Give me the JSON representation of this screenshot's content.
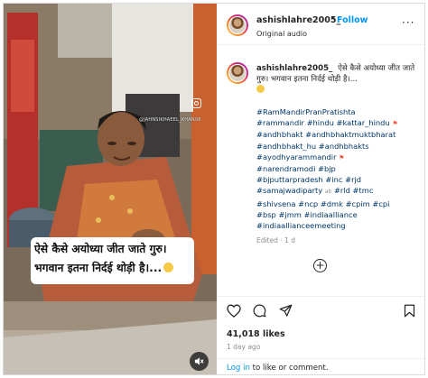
{
  "media": {
    "watermark": "@JAHNSIKHAEEL_KHAN98",
    "caption_line1": "ऐसे कैसे अयोध्या जीत जाते गुरु।",
    "caption_line2": "भगवान इतना निर्दई थोड़ी है।...",
    "mute_icon": "speaker-muted-icon"
  },
  "header": {
    "username": "ashishlahre2005_",
    "dot": "•",
    "follow_label": "Follow",
    "audio_label": "Original audio",
    "more_icon": "more-horizontal-icon",
    "more_label": "···"
  },
  "caption": {
    "username": "ashishlahre2005_",
    "text": "ऐसे कैसे अयोध्या जीत जाते गुरु। भगवान इतना निर्दई थोड़ी है।..."
  },
  "hashtag_lines": [
    {
      "text": "#RamMandirPranPratishta",
      "flag": false,
      "sub": ""
    },
    {
      "text": "#rammandir #hindu #kattar_hindu",
      "flag": true,
      "sub": ""
    },
    {
      "text": "#andhbhakt #andhbhaktmuktbharat",
      "flag": false,
      "sub": ""
    },
    {
      "text": "#andhbhakt_hu #andhbhakts",
      "flag": false,
      "sub": ""
    },
    {
      "text": "#ayodhyarammandir",
      "flag": true,
      "sub": ""
    },
    {
      "text": "#narendramodi #bjp",
      "flag": false,
      "sub": ""
    },
    {
      "text": "#bjputtarpradesh #inc #rjd",
      "flag": false,
      "sub": ""
    },
    {
      "text": "#samajwadiparty",
      "flag": false,
      "sub": "ab",
      "rest": " #rld #tmc"
    },
    {
      "text": "#shivsena #ncp #dmk #cpim #cpi",
      "flag": false,
      "sub": ""
    },
    {
      "text": "#bsp #jmm #indiaalliance",
      "flag": false,
      "sub": ""
    },
    {
      "text": "#indiaallianceemeeting",
      "flag": false,
      "sub": ""
    }
  ],
  "edited_label": "Edited · 1 d",
  "add_comment_icon": "plus-circle-icon",
  "actions": {
    "like_icon": "heart-icon",
    "comment_icon": "comment-bubble-icon",
    "share_icon": "paper-plane-icon",
    "save_icon": "bookmark-icon"
  },
  "likes_count": "41,018 likes",
  "time_ago": "1 day ago",
  "login": {
    "link": "Log in",
    "rest": " to like or comment."
  },
  "colors": {
    "accent": "#0095f6",
    "link": "#00376b",
    "muted": "#8e8e8e"
  }
}
